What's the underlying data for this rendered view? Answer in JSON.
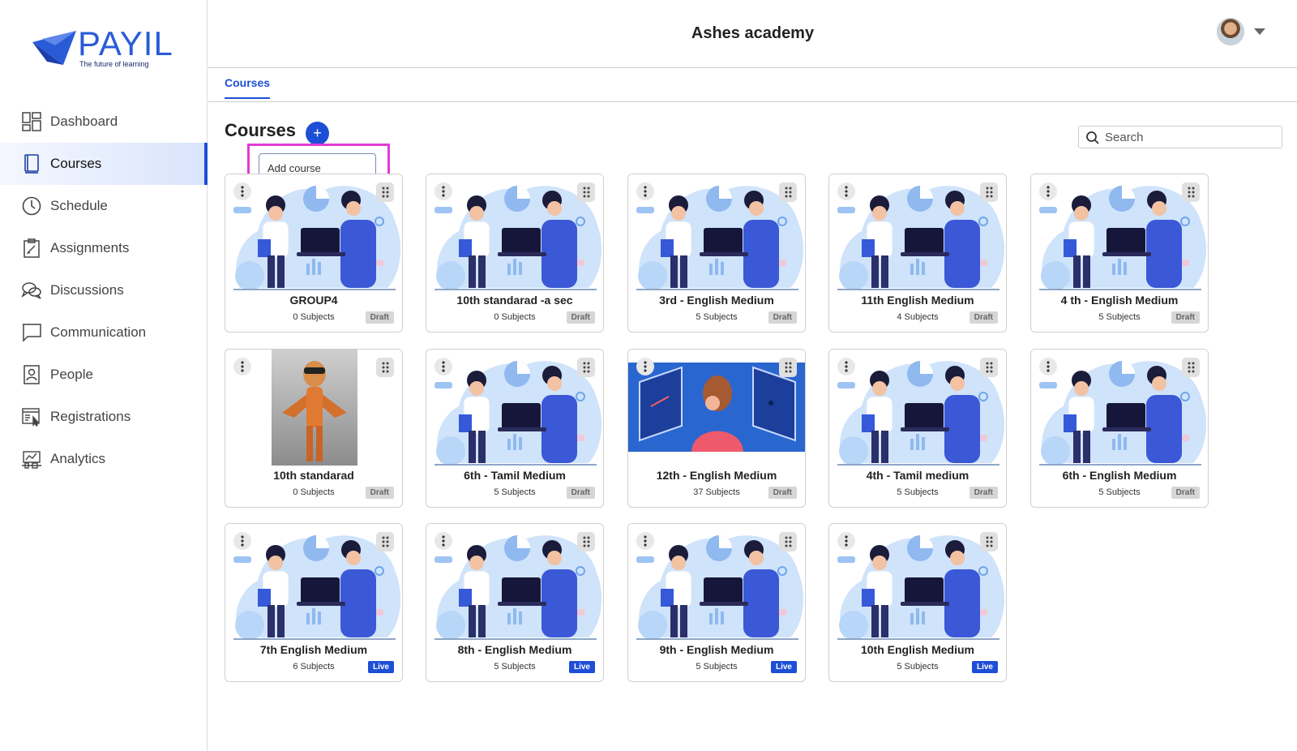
{
  "brand": {
    "name": "PAYIL",
    "tagline": "The future of learning",
    "color": "#2a5bd7"
  },
  "header": {
    "title": "Ashes academy"
  },
  "nav": [
    {
      "label": "Dashboard",
      "icon": "dashboard-icon"
    },
    {
      "label": "Courses",
      "icon": "book-icon",
      "active": true
    },
    {
      "label": "Schedule",
      "icon": "clock-icon"
    },
    {
      "label": "Assignments",
      "icon": "assignment-icon"
    },
    {
      "label": "Discussions",
      "icon": "discussion-icon"
    },
    {
      "label": "Communication",
      "icon": "chat-icon"
    },
    {
      "label": "People",
      "icon": "people-icon"
    },
    {
      "label": "Registrations",
      "icon": "registration-icon"
    },
    {
      "label": "Analytics",
      "icon": "analytics-icon"
    }
  ],
  "tabs": [
    {
      "label": "Courses",
      "active": true
    }
  ],
  "page": {
    "heading": "Courses",
    "add_button": "+",
    "add_tooltip": "Add course"
  },
  "search": {
    "placeholder": "Search"
  },
  "accent_color": "#1d4fd6",
  "courses": [
    {
      "name": "GROUP4",
      "subjects": "0 Subjects",
      "status": "Draft",
      "image": "illustration"
    },
    {
      "name": "10th standarad -a sec",
      "subjects": "0 Subjects",
      "status": "Draft",
      "image": "illustration"
    },
    {
      "name": "3rd - English Medium",
      "subjects": "5 Subjects",
      "status": "Draft",
      "image": "illustration"
    },
    {
      "name": "11th English Medium",
      "subjects": "4 Subjects",
      "status": "Draft",
      "image": "illustration"
    },
    {
      "name": "4 th - English Medium",
      "subjects": "5 Subjects",
      "status": "Draft",
      "image": "illustration"
    },
    {
      "name": "10th standarad",
      "subjects": "0 Subjects",
      "status": "Draft",
      "image": "character"
    },
    {
      "name": "6th - Tamil Medium",
      "subjects": "5 Subjects",
      "status": "Draft",
      "image": "illustration"
    },
    {
      "name": "12th - English Medium",
      "subjects": "37 Subjects",
      "status": "Draft",
      "image": "vr"
    },
    {
      "name": "4th - Tamil medium",
      "subjects": "5 Subjects",
      "status": "Draft",
      "image": "illustration"
    },
    {
      "name": "6th - English Medium",
      "subjects": "5 Subjects",
      "status": "Draft",
      "image": "illustration"
    },
    {
      "name": "7th English Medium",
      "subjects": "6 Subjects",
      "status": "Live",
      "image": "illustration"
    },
    {
      "name": "8th - English Medium",
      "subjects": "5 Subjects",
      "status": "Live",
      "image": "illustration"
    },
    {
      "name": "9th - English Medium",
      "subjects": "5 Subjects",
      "status": "Live",
      "image": "illustration"
    },
    {
      "name": "10th English Medium",
      "subjects": "5 Subjects",
      "status": "Live",
      "image": "illustration"
    }
  ]
}
